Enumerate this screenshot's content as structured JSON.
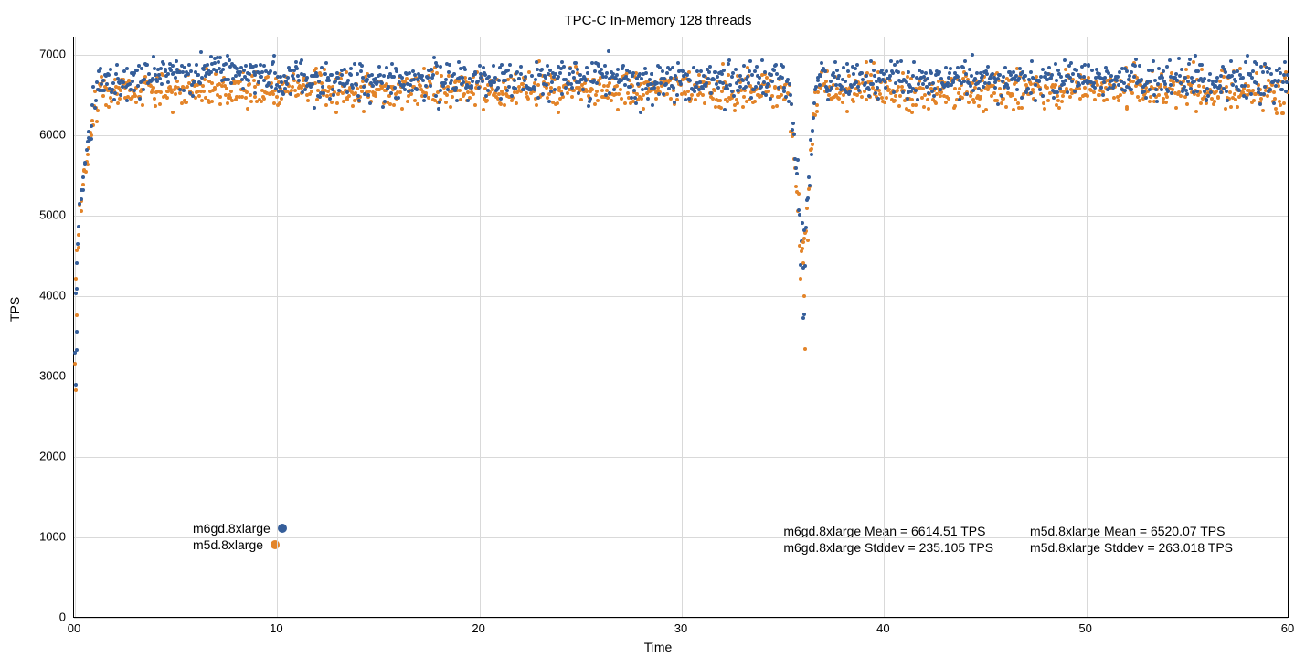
{
  "chart_data": {
    "type": "scatter",
    "title": "TPC-C In-Memory 128 threads",
    "xlabel": "Time",
    "ylabel": "TPS",
    "xlim": [
      0,
      60
    ],
    "ylim": [
      0,
      7200
    ],
    "xticks": [
      "00",
      "10",
      "20",
      "30",
      "40",
      "50",
      "60"
    ],
    "yticks": [
      0,
      1000,
      2000,
      3000,
      4000,
      5000,
      6000,
      7000
    ],
    "series": [
      {
        "name": "m6gd.8xlarge",
        "color": "#355e9a",
        "mean_label": "m6gd.8xlarge Mean = 6614.51 TPS",
        "stddev_label": "m6gd.8xlarge Stddev = 235.105 TPS",
        "profile": "A"
      },
      {
        "name": "m5d.8xlarge",
        "color": "#e38429",
        "mean_label": "m5d.8xlarge Mean = 6520.07 TPS",
        "stddev_label": "m5d.8xlarge Stddev = 263.018 TPS",
        "profile": "B"
      }
    ],
    "stats_grid": [
      "m6gd.8xlarge Mean = 6614.51 TPS",
      "m5d.8xlarge Mean = 6520.07 TPS",
      "m6gd.8xlarge Stddev = 235.105 TPS",
      "m5d.8xlarge Stddev = 263.018 TPS"
    ],
    "dip": {
      "x_center": 36.0,
      "x_width": 0.8,
      "y_min_A": 3700,
      "y_min_B": 3340
    },
    "startup": {
      "x_end": 1.2,
      "y_start": 2800
    },
    "band": {
      "A_center": 6680,
      "A_sd": 180,
      "B_center": 6560,
      "B_sd": 180
    },
    "n_points_per_series": 1300
  }
}
